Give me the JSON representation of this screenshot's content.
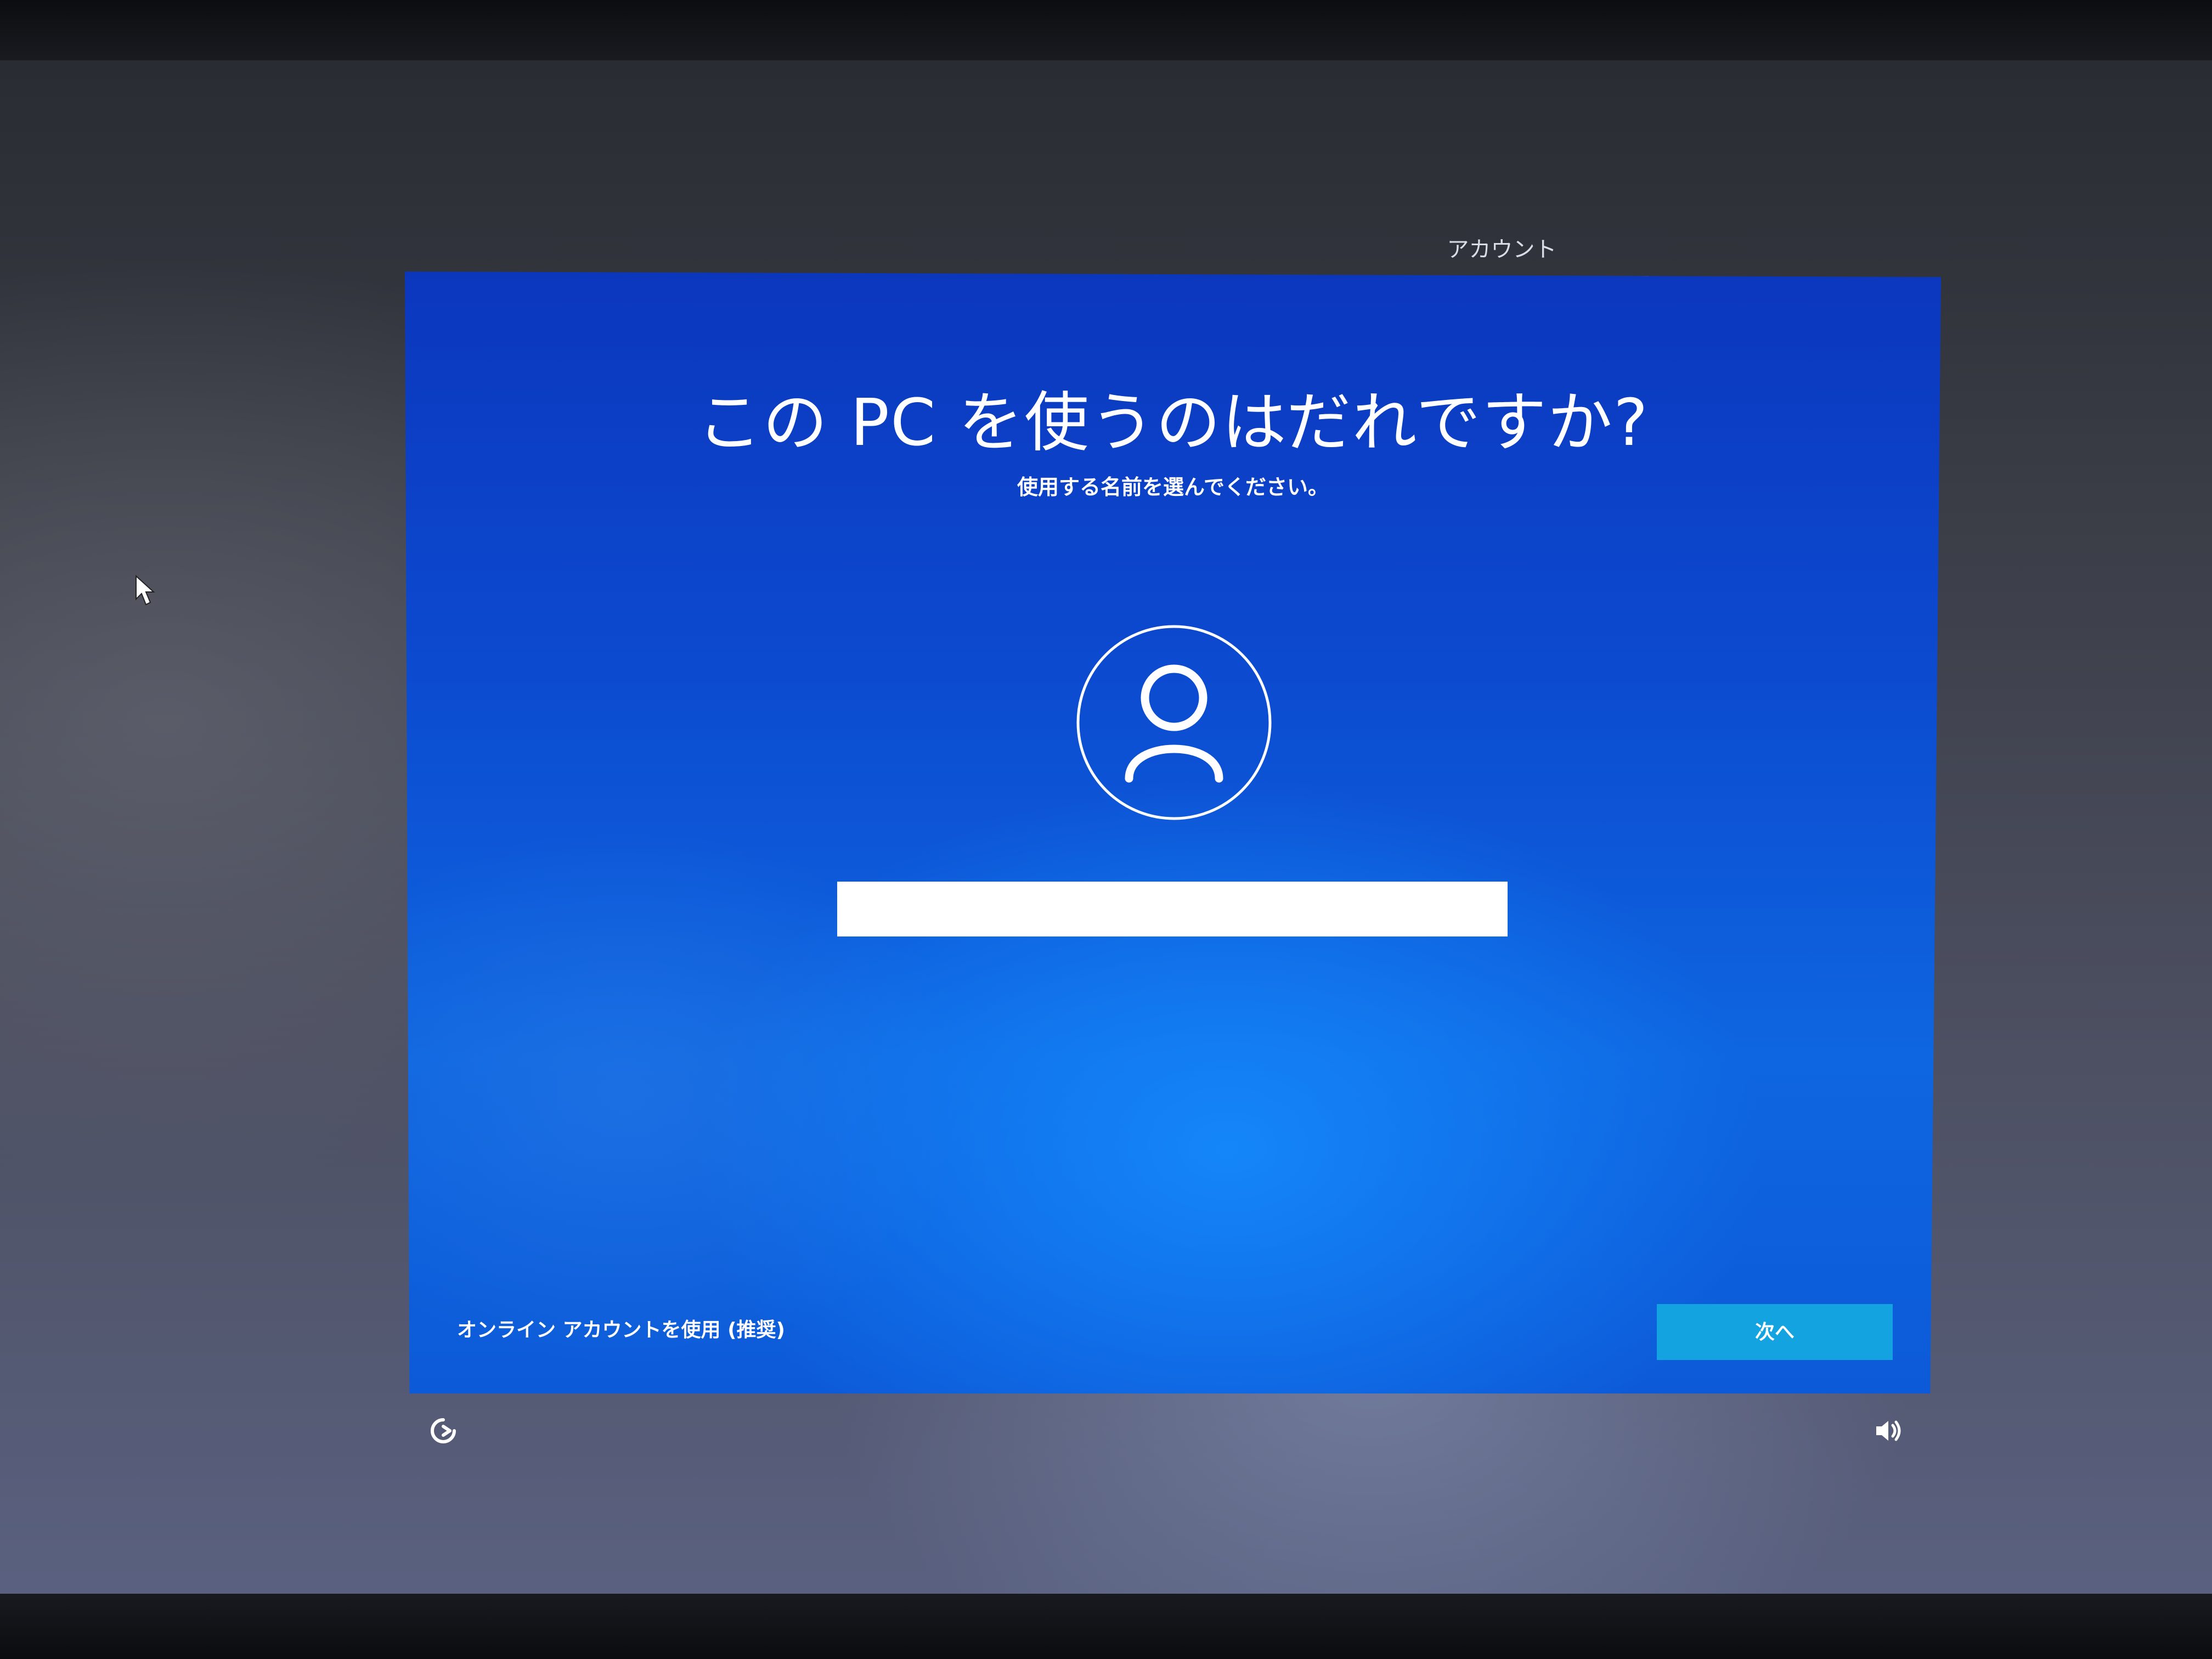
{
  "header": {
    "active_step": "アカウント"
  },
  "main": {
    "title": "この PC を使うのはだれですか?",
    "subtitle": "使用する名前を選んでください。",
    "avatar_icon": "user-avatar-icon",
    "name_input": {
      "value": "",
      "placeholder": ""
    }
  },
  "footer": {
    "online_account_link": "オンライン アカウントを使用 (推奨)",
    "next_button": "次へ"
  },
  "system": {
    "accessibility_icon": "ease-of-access-icon",
    "volume_icon": "volume-icon"
  },
  "colors": {
    "panel_blue": "#0c4ad0",
    "button_accent": "#13a3e0",
    "text": "#ffffff"
  }
}
